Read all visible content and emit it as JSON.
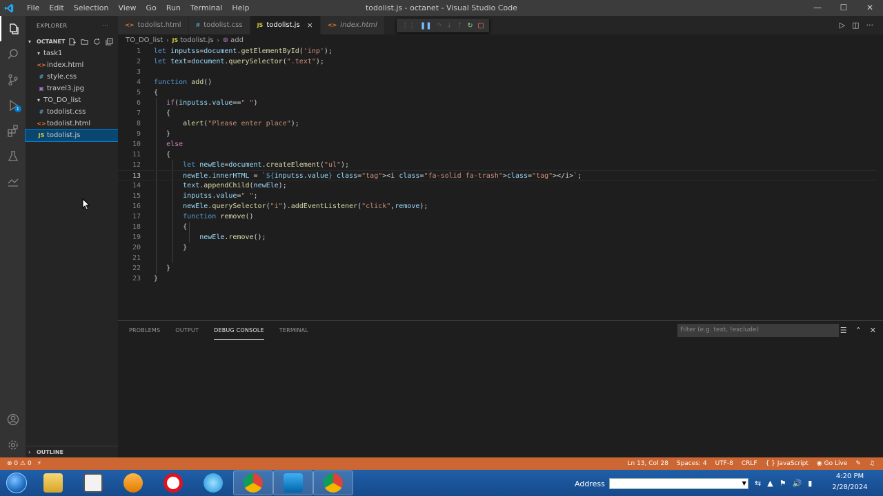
{
  "window": {
    "title": "todolist.js - octanet - Visual Studio Code",
    "menu": [
      "File",
      "Edit",
      "Selection",
      "View",
      "Go",
      "Run",
      "Terminal",
      "Help"
    ]
  },
  "activity_bar": {
    "items": [
      "explorer-icon",
      "search-icon",
      "source-control-icon",
      "run-debug-icon",
      "extensions-icon",
      "testing-icon",
      "remote-icon"
    ],
    "debug_badge": "1",
    "bottom": [
      "account-icon",
      "settings-gear-icon"
    ]
  },
  "sidebar": {
    "header": "EXPLORER",
    "header_more": "···",
    "workspace": "OCTANET",
    "tree": [
      {
        "label": "task1",
        "kind": "folder",
        "depth": 1
      },
      {
        "label": "index.html",
        "kind": "html",
        "depth": 2
      },
      {
        "label": "style.css",
        "kind": "css",
        "depth": 2
      },
      {
        "label": "travel3.jpg",
        "kind": "image",
        "depth": 2
      },
      {
        "label": "TO_DO_list",
        "kind": "folder",
        "depth": 1
      },
      {
        "label": "todolist.css",
        "kind": "css",
        "depth": 2
      },
      {
        "label": "todolist.html",
        "kind": "html",
        "depth": 2
      },
      {
        "label": "todolist.js",
        "kind": "js",
        "depth": 2,
        "selected": true
      }
    ],
    "outline": "OUTLINE"
  },
  "tabs": [
    {
      "label": "todolist.html",
      "icon": "<>",
      "icon_color": "#e37933"
    },
    {
      "label": "todolist.css",
      "icon": "#",
      "icon_color": "#519aba"
    },
    {
      "label": "todolist.js",
      "icon": "JS",
      "icon_color": "#cbcb41",
      "active": true,
      "close": "×"
    },
    {
      "label": "index.html",
      "icon": "<>",
      "icon_color": "#e37933",
      "italic": true
    }
  ],
  "breadcrumb": {
    "folder": "TO_DO_list",
    "file": "todolist.js",
    "file_icon": "JS",
    "symbol": "add"
  },
  "editor": {
    "current_line": 13,
    "lines": [
      "let inputss=document.getElementById('inp');",
      "let text=document.querySelector(\".text\");",
      "",
      "function add()",
      "{",
      "   if(inputss.value==\" \")",
      "   {",
      "       alert(\"Please enter place\");",
      "   }",
      "   else",
      "   {",
      "       let newEle=document.createElement(\"ul\");",
      "       newEle.innerHTML = `${inputss.value} <i class=\"fa-solid fa-trash\"></i>`;",
      "       text.appendChild(newEle);",
      "       inputss.value=\" \";",
      "       newEle.querySelector(\"i\").addEventListener(\"click\",remove);",
      "       function remove()",
      "       {",
      "           newEle.remove();",
      "       }",
      "",
      "   }",
      "}"
    ]
  },
  "panel": {
    "tabs": [
      "PROBLEMS",
      "OUTPUT",
      "DEBUG CONSOLE",
      "TERMINAL"
    ],
    "active_tab": "DEBUG CONSOLE",
    "filter_placeholder": "Filter (e.g. text, !exclude)"
  },
  "statusbar": {
    "errors": "0",
    "warnings": "0",
    "position": "Ln 13, Col 28",
    "spaces": "Spaces: 4",
    "encoding": "UTF-8",
    "eol": "CRLF",
    "language": "JavaScript",
    "golive": "Go Live",
    "color": "#cc6633"
  },
  "taskbar": {
    "apps": [
      "windows-explorer-icon",
      "calculator-icon",
      "media-player-icon",
      "opera-icon",
      "internet-explorer-icon",
      "chrome-icon",
      "vscode-icon",
      "chrome-icon"
    ],
    "address_label": "Address",
    "time": "4:20 PM",
    "date": "2/28/2024"
  }
}
